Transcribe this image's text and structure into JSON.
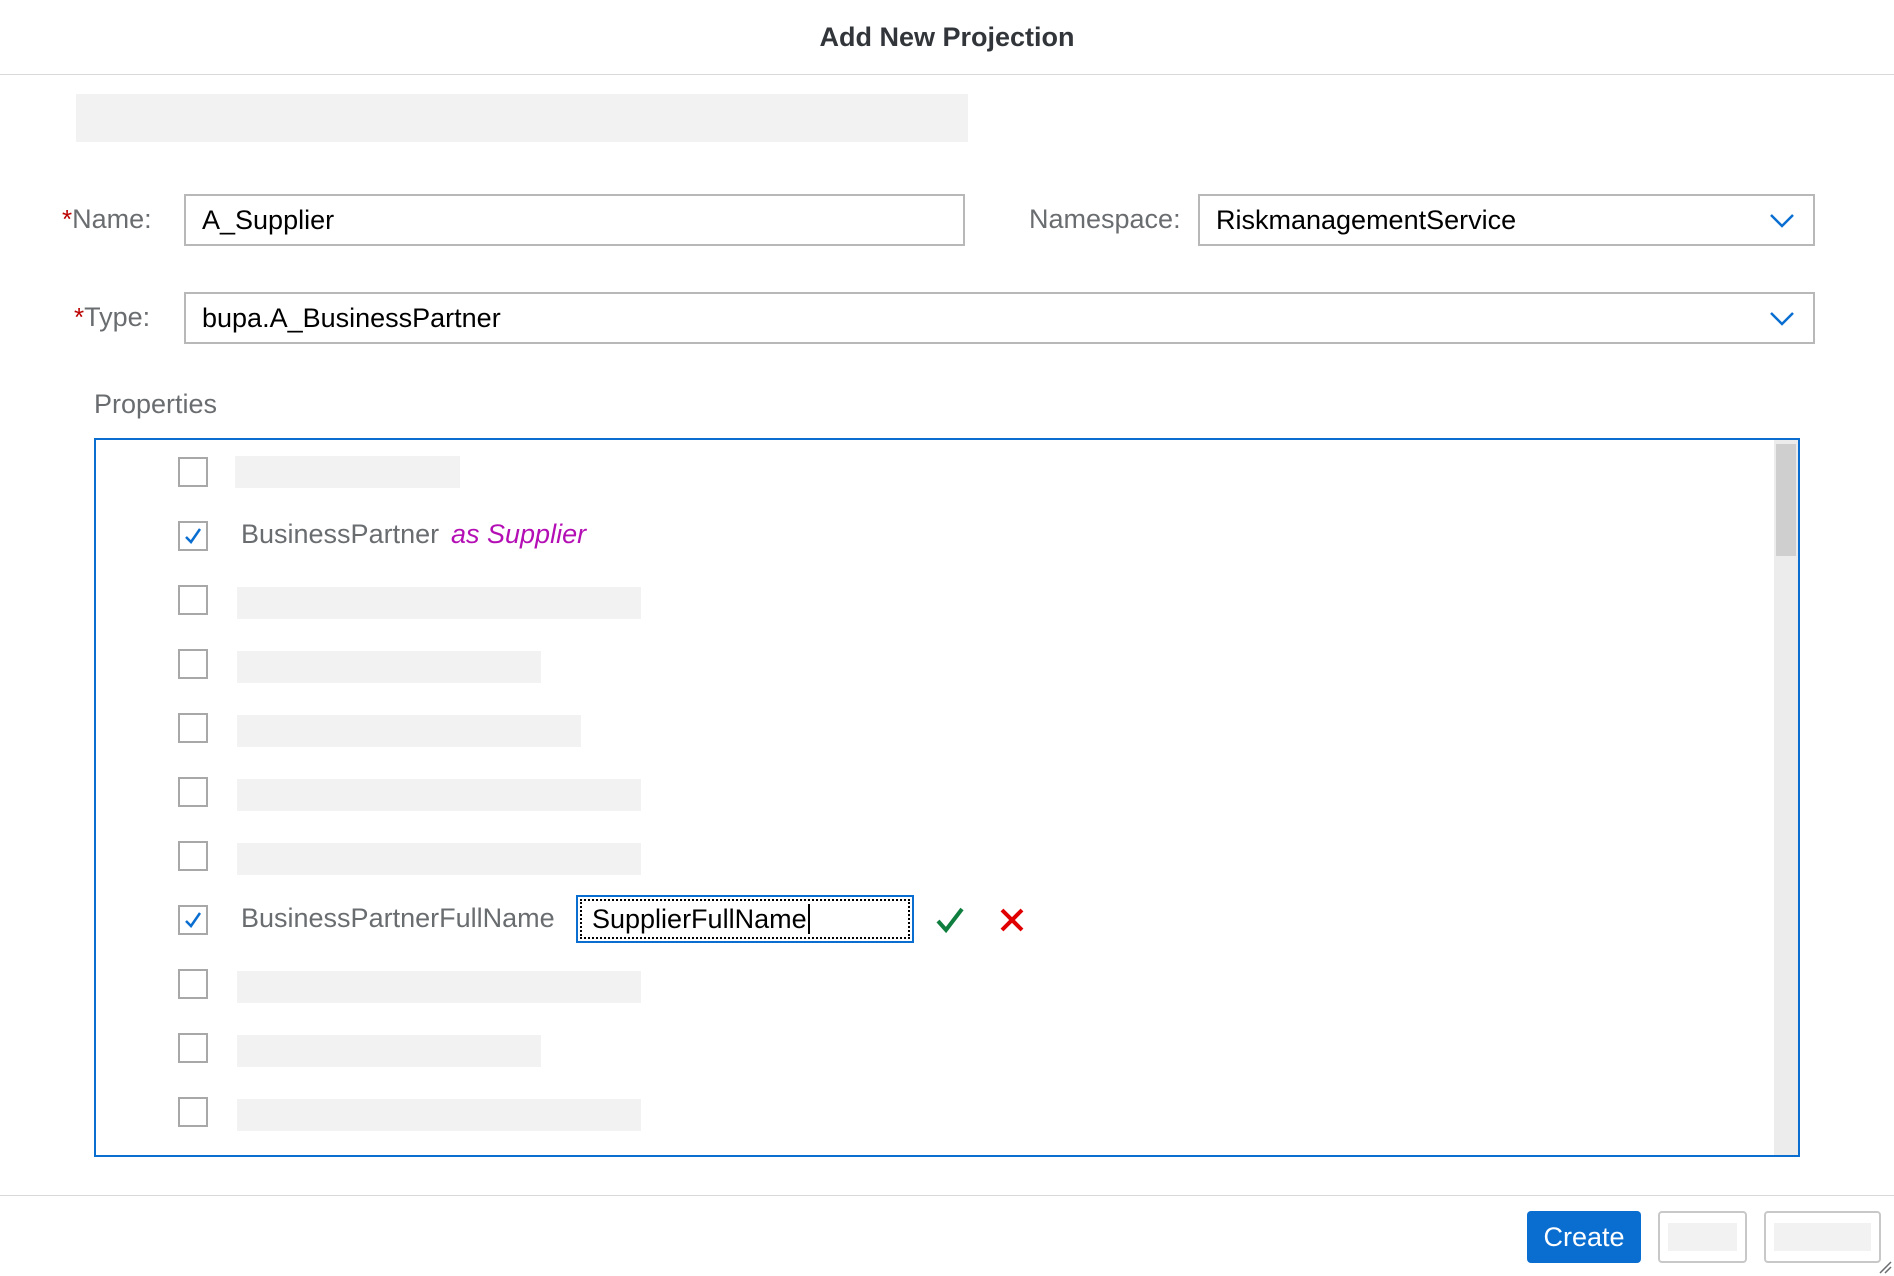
{
  "dialog": {
    "title": "Add New Projection"
  },
  "form": {
    "required_mark": "*",
    "name": {
      "label": "Name:",
      "value": "A_Supplier"
    },
    "namespace": {
      "label": "Namespace:",
      "value": "RiskmanagementService",
      "icon": "chevron-down-icon"
    },
    "type": {
      "label": "Type:",
      "value": "bupa.A_BusinessPartner",
      "icon": "chevron-down-icon"
    }
  },
  "properties": {
    "label": "Properties",
    "items": [
      {
        "checked": false,
        "label": ""
      },
      {
        "checked": true,
        "label": "BusinessPartner",
        "alias": "as Supplier"
      },
      {
        "checked": false,
        "label": ""
      },
      {
        "checked": false,
        "label": ""
      },
      {
        "checked": false,
        "label": ""
      },
      {
        "checked": false,
        "label": ""
      },
      {
        "checked": false,
        "label": ""
      },
      {
        "checked": true,
        "label": "BusinessPartnerFullName",
        "edit_value": "SupplierFullName"
      },
      {
        "checked": false,
        "label": ""
      },
      {
        "checked": false,
        "label": ""
      },
      {
        "checked": false,
        "label": ""
      }
    ],
    "confirm_icon": "checkmark-icon",
    "cancel_icon": "close-icon"
  },
  "footer": {
    "create_label": "Create"
  },
  "colors": {
    "accent": "#0a6ed1",
    "alias": "#b40fb5",
    "confirm": "#107e3e",
    "cancel": "#e00000",
    "required": "#bb0000"
  }
}
